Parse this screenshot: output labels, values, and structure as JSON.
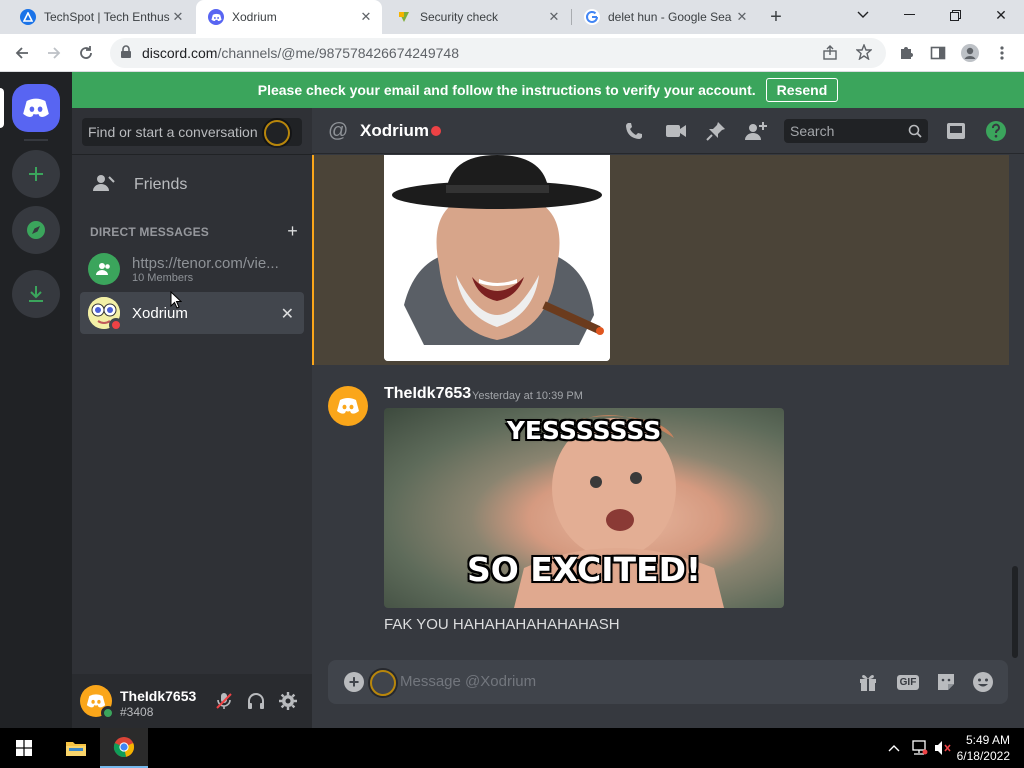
{
  "browser": {
    "tabs": [
      {
        "title": "TechSpot | Tech Enthusi",
        "active": false
      },
      {
        "title": "Xodrium",
        "active": true
      },
      {
        "title": "Security check",
        "active": false
      },
      {
        "title": "delet hun - Google Sea",
        "active": false
      }
    ],
    "url_host": "discord.com",
    "url_path": "/channels/@me/987578426674249748"
  },
  "banner": {
    "text": "Please check your email and follow the instructions to verify your account.",
    "button": "Resend"
  },
  "sidebar": {
    "search_placeholder": "Find or start a conversation",
    "friends_label": "Friends",
    "dm_header": "DIRECT MESSAGES",
    "dms": [
      {
        "name": "https://tenor.com/vie...",
        "sub": "10 Members",
        "active": false
      },
      {
        "name": "Xodrium",
        "sub": "",
        "active": true
      }
    ]
  },
  "user": {
    "name": "TheIdk7653",
    "tag": "#3408"
  },
  "channel": {
    "name": "Xodrium",
    "search_placeholder": "Search"
  },
  "messages": [
    {
      "author": "TheIdk7653",
      "timestamp": "Yesterday at 10:39 PM",
      "gif_caption_top": "YESSSSSSS",
      "gif_caption_bottom": "SO EXCITED!",
      "text": "FAK YOU HAHAHAHAHAHAHASH"
    }
  ],
  "composer": {
    "placeholder": "Message @Xodrium",
    "gif_label": "GIF"
  },
  "taskbar": {
    "time": "5:49 AM",
    "date": "6/18/2022"
  },
  "colors": {
    "blurple": "#5865f2",
    "green": "#3ba55c",
    "red": "#ed4245",
    "orange": "#faa61a"
  }
}
